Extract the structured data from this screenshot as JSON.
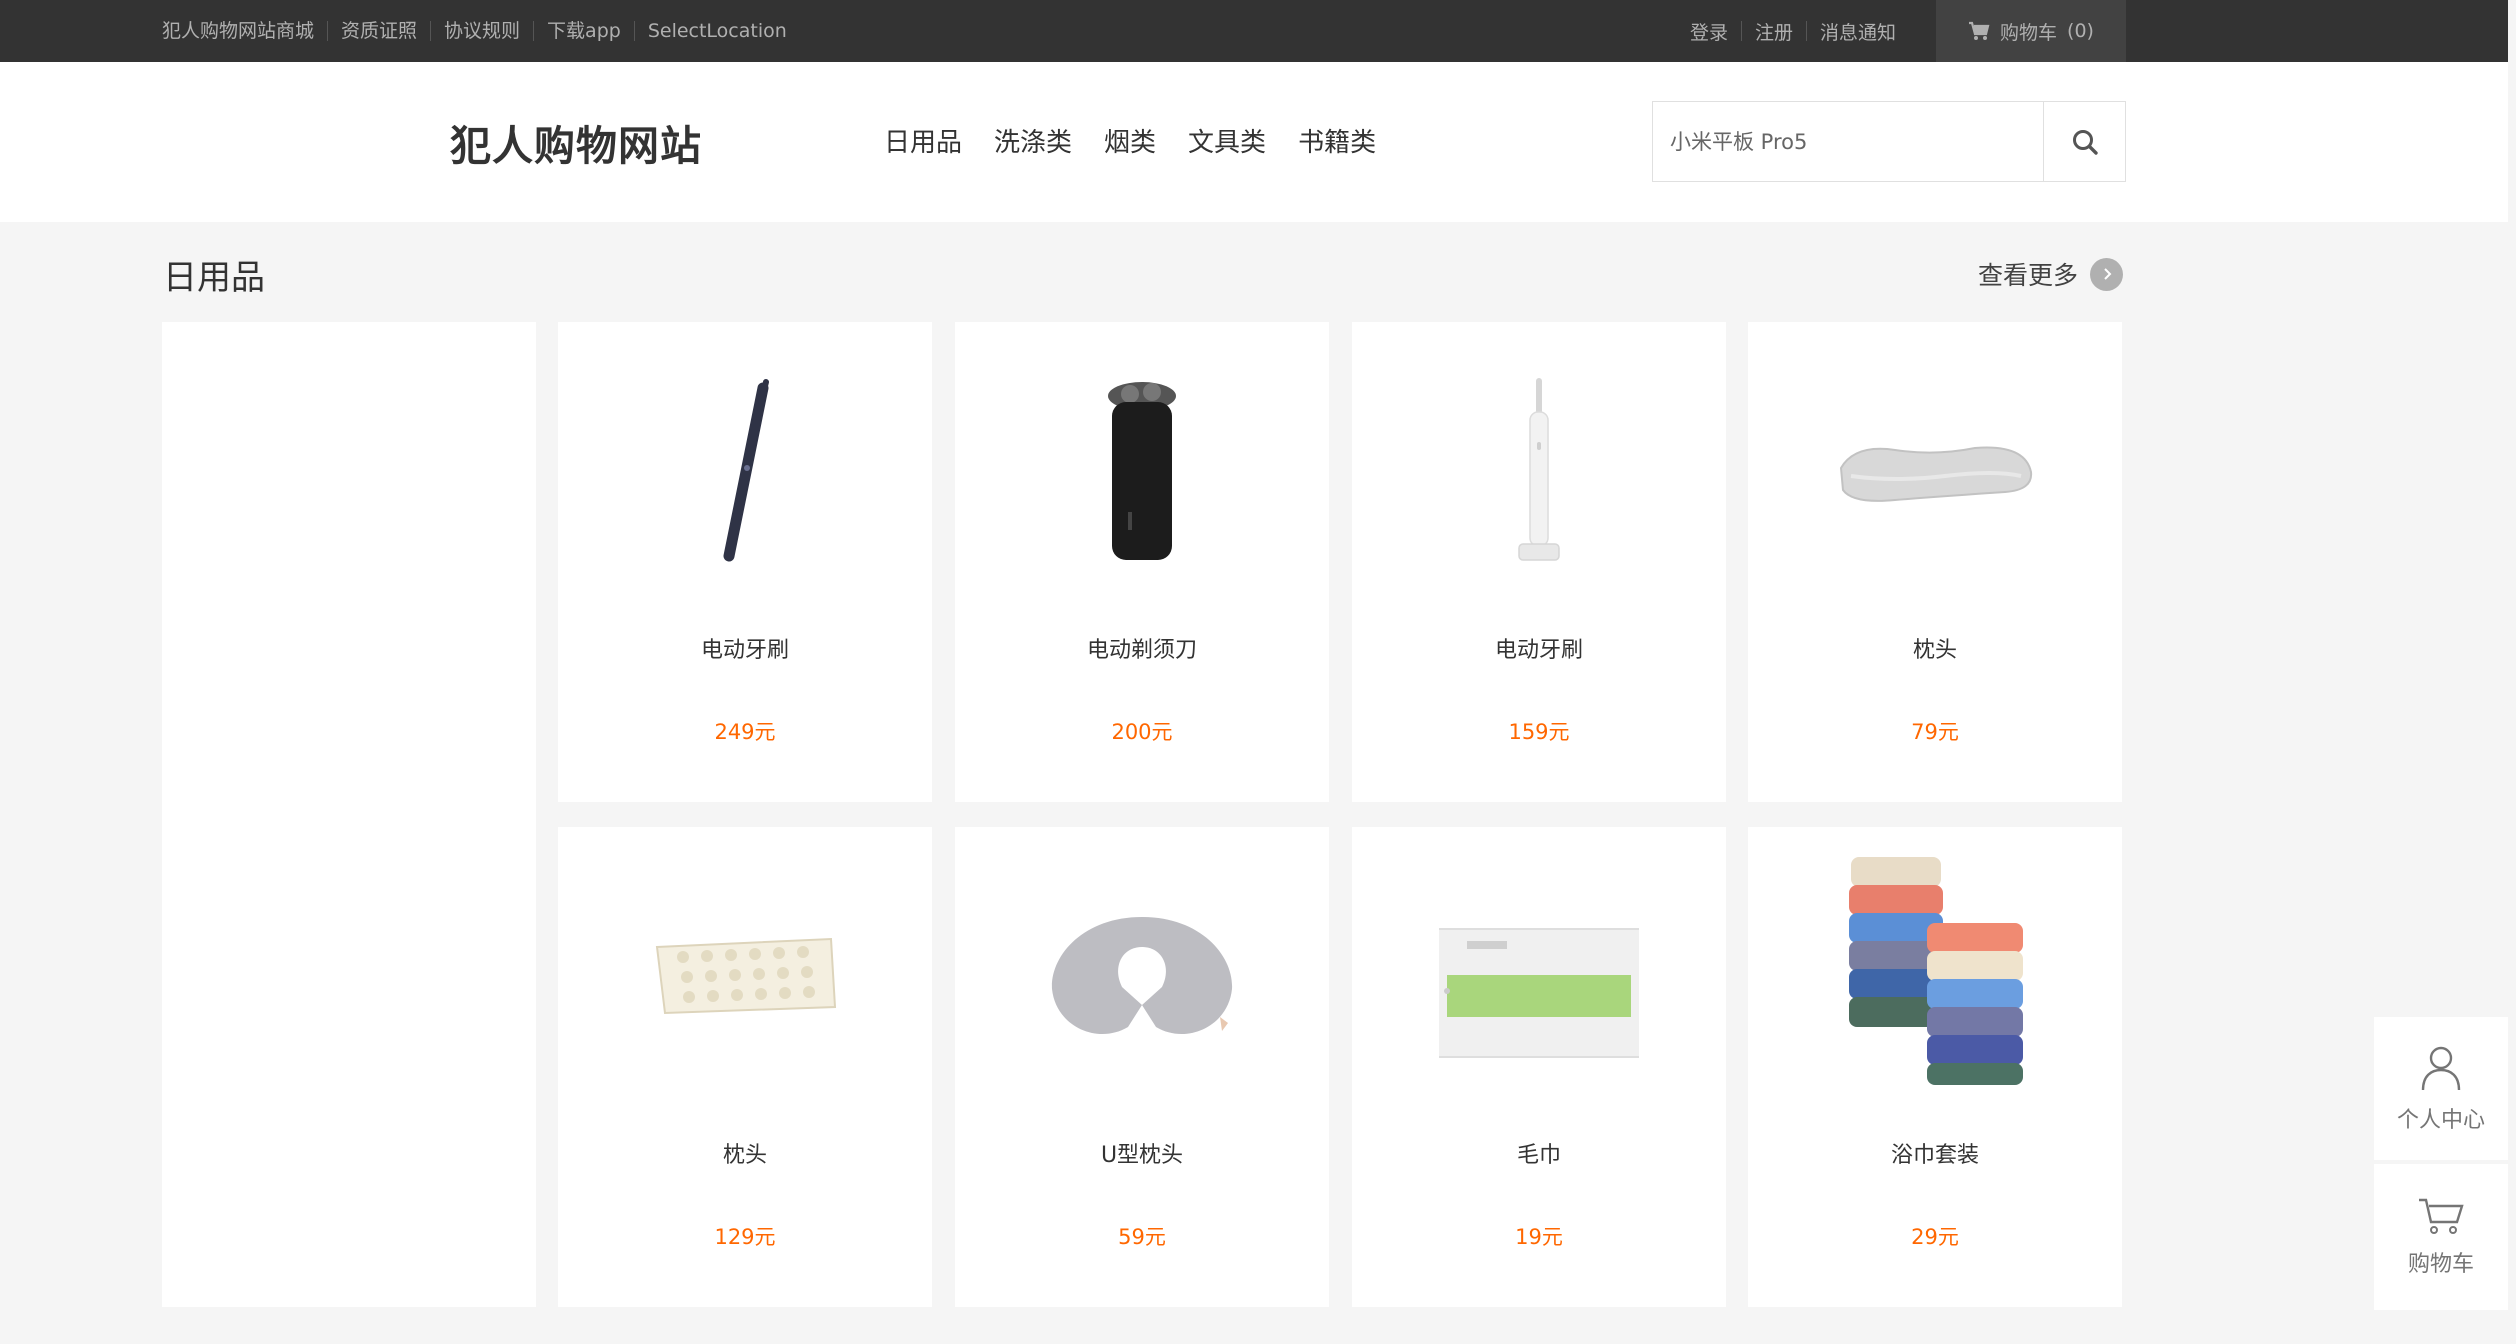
{
  "topbar": {
    "links": [
      "犯人购物网站商城",
      "资质证照",
      "协议规则",
      "下载app",
      "SelectLocation"
    ],
    "login": "登录",
    "register": "注册",
    "messages": "消息通知",
    "cart_label": "购物车",
    "cart_count": "(0)"
  },
  "header": {
    "logo": "犯人购物网站",
    "nav": [
      "日用品",
      "洗涤类",
      "烟类",
      "文具类",
      "书籍类"
    ],
    "search_placeholder": "小米平板 Pro5"
  },
  "section": {
    "title": "日用品",
    "more": "查看更多"
  },
  "products": [
    {
      "name": "电动牙刷",
      "price": "249元",
      "icon": "toothbrush-dark"
    },
    {
      "name": "电动剃须刀",
      "price": "200元",
      "icon": "shaver"
    },
    {
      "name": "电动牙刷",
      "price": "159元",
      "icon": "toothbrush-white"
    },
    {
      "name": "枕头",
      "price": "79元",
      "icon": "pillow-contour"
    },
    {
      "name": "枕头",
      "price": "129元",
      "icon": "pillow-latex"
    },
    {
      "name": "U型枕头",
      "price": "59元",
      "icon": "u-pillow"
    },
    {
      "name": "毛巾",
      "price": "19元",
      "icon": "towel-box"
    },
    {
      "name": "浴巾套装",
      "price": "29元",
      "icon": "towel-stack"
    }
  ],
  "floatbar": {
    "user_center": "个人中心",
    "cart": "购物车"
  },
  "colors": {
    "topbar": "#333333",
    "price": "#ff6700",
    "background": "#f5f5f5"
  }
}
